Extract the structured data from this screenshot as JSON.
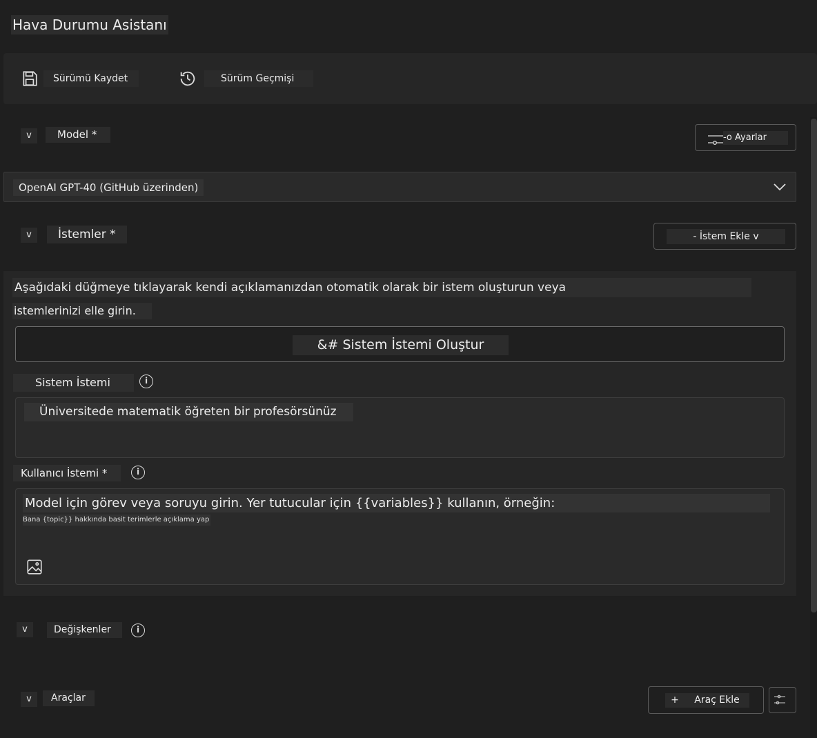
{
  "app": {
    "title": "Hava Durumu Asistanı"
  },
  "toolbar": {
    "save_label": "Sürümü Kaydet",
    "history_label": "Sürüm Geçmişi"
  },
  "model_section": {
    "title": "Model *",
    "settings_label": "-o Ayarlar",
    "selected_model": "OpenAI GPT-40 (GitHub üzerinden)"
  },
  "prompts_section": {
    "title": "İstemler *",
    "add_prompt_label": "- İstem Ekle v",
    "description_line1": "Aşağıdaki düğmeye tıklayarak kendi açıklamanızdan otomatik olarak bir istem oluşturun veya",
    "description_line2": "istemlerinizi elle girin.",
    "generate_label": "&# Sistem İstemi Oluştur",
    "system_prompt_label": "Sistem İstemi",
    "system_prompt_value": "Üniversitede matematik öğreten bir profesörsünüz",
    "user_prompt_label": "Kullanıcı İstemi *",
    "user_prompt_placeholder": "Model için görev veya soruyu girin. Yer tutucular için {{variables}} kullanın, örneğin:",
    "user_prompt_example": "Bana {topic}} hakkında basit terimlerle açıklama yap"
  },
  "variables_section": {
    "title": "Değişkenler"
  },
  "tools_section": {
    "title": "Araçlar",
    "add_tool_label": "Araç Ekle",
    "add_tool_plus": "+"
  },
  "icons": {
    "save": "save-icon",
    "history": "history-icon",
    "dropdown": "chevron-down-icon",
    "info": "info-icon",
    "image": "image-icon",
    "collapse": "collapse-chevron-icon",
    "tool_settings": "tool-settings-icon"
  },
  "colors": {
    "background": "#1f1f1f",
    "panel": "#262626",
    "text": "#e6e6e6",
    "border": "#5a5a5a"
  }
}
